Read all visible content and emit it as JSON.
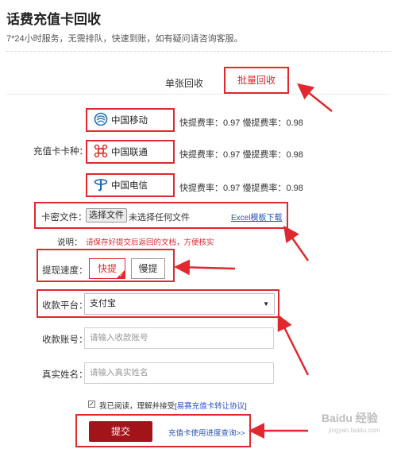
{
  "header": {
    "title": "话费充值卡回收",
    "subtitle": "7*24小时服务，无需排队，快速到账，如有疑问请咨询客服。"
  },
  "tabs": [
    {
      "label": "单张回收",
      "active": false
    },
    {
      "label": "批量回收",
      "active": true
    }
  ],
  "form": {
    "card_type_label": "充值卡卡种：",
    "carriers": [
      {
        "name": "中国移动",
        "icon": "china-mobile-logo",
        "rate_text": "快提费率：0.97   慢提费率：0.98"
      },
      {
        "name": "中国联通",
        "icon": "china-unicom-logo",
        "rate_text": "快提费率：0.97   慢提费率：0.98"
      },
      {
        "name": "中国电信",
        "icon": "china-telecom-logo",
        "rate_text": "快提费率：0.97   慢提费率：0.98"
      }
    ],
    "file_label": "卡密文件：",
    "file_button": "选择文件",
    "file_status": "未选择任何文件",
    "excel_link": "Excel模板下载",
    "note_label": "说明：",
    "note_text": "请保存好提交后返回的文档，方便核实",
    "speed_label": "提现速度：",
    "speed_fast": "快提",
    "speed_slow": "慢提",
    "platform_label": "收款平台：",
    "platform_value": "支付宝",
    "account_label": "收款账号：",
    "account_placeholder": "请输入收款账号",
    "name_label": "真实姓名：",
    "name_placeholder": "请输入真实姓名",
    "agree_text": "我已阅读，理解并接受[",
    "agree_link": "易赛充值卡转让协议",
    "agree_end": "]",
    "submit_label": "提交",
    "progress_link": "充值卡使用进度查询>>"
  },
  "watermark": {
    "brand": "Baidu 经验",
    "url": "jingyan.baidu.com"
  },
  "colors": {
    "accent": "#e0282e",
    "submit": "#a3131a",
    "link": "#2a52be"
  }
}
